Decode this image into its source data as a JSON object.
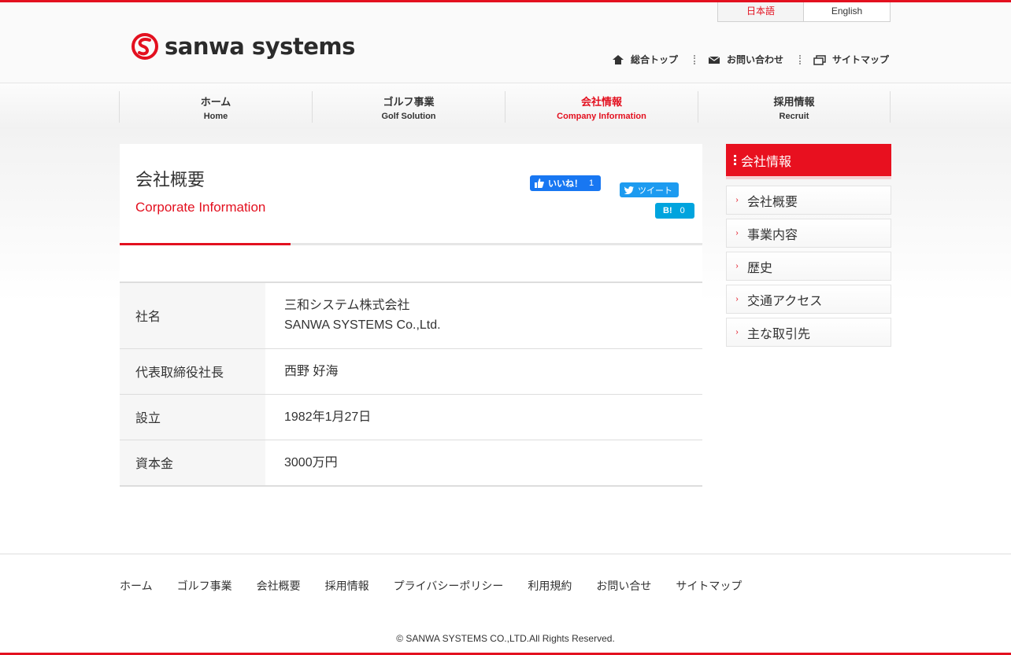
{
  "header": {
    "logo_text": "sanwa systems",
    "lang": [
      {
        "label": "日本語"
      },
      {
        "label": "English"
      }
    ],
    "utility": [
      {
        "label": "総合トップ",
        "icon": "home-icon"
      },
      {
        "label": "お問い合わせ",
        "icon": "mail-icon"
      },
      {
        "label": "サイトマップ",
        "icon": "sitemap-icon"
      }
    ]
  },
  "nav": [
    {
      "ja": "ホーム",
      "en": "Home"
    },
    {
      "ja": "ゴルフ事業",
      "en": "Golf Solution"
    },
    {
      "ja": "会社情報",
      "en": "Company Information"
    },
    {
      "ja": "採用情報",
      "en": "Recruit"
    }
  ],
  "main": {
    "title": "会社概要",
    "subtitle": "Corporate Information",
    "social": {
      "fb_label": "いいね！",
      "fb_count": "1",
      "tw_label": "ツイート",
      "hb_label": "B!",
      "hb_count": "0"
    },
    "rows": [
      {
        "label": "社名",
        "value_line1": "三和システム株式会社",
        "value_line2": "SANWA SYSTEMS Co.,Ltd."
      },
      {
        "label": "代表取締役社長",
        "value_line1": "西野 好海"
      },
      {
        "label": "設立",
        "value_line1": "1982年1月27日"
      },
      {
        "label": "資本金",
        "value_line1": "3000万円"
      }
    ]
  },
  "sidebar": {
    "title": "会社情報",
    "items": [
      {
        "label": "会社概要"
      },
      {
        "label": "事業内容"
      },
      {
        "label": "歴史"
      },
      {
        "label": "交通アクセス"
      },
      {
        "label": "主な取引先"
      }
    ]
  },
  "footer": {
    "links": [
      "ホーム",
      "ゴルフ事業",
      "会社概要",
      "採用情報",
      "プライバシーポリシー",
      "利用規約",
      "お問い合せ",
      "サイトマップ"
    ],
    "copyright": "© SANWA SYSTEMS CO.,LTD.All Rights Reserved."
  },
  "colors": {
    "accent": "#e3101f",
    "facebook": "#1877f2",
    "twitter": "#1d9bf0",
    "hatena": "#00a4de"
  }
}
